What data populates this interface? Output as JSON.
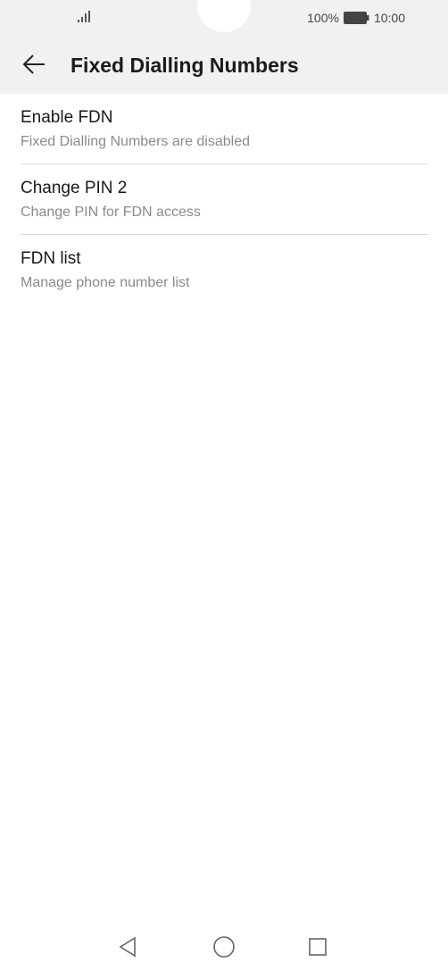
{
  "status_bar": {
    "battery_percent": "100%",
    "time": "10:00"
  },
  "header": {
    "title": "Fixed Dialling Numbers"
  },
  "items": [
    {
      "title": "Enable FDN",
      "subtitle": "Fixed Dialling Numbers are disabled"
    },
    {
      "title": "Change PIN 2",
      "subtitle": "Change PIN for FDN access"
    },
    {
      "title": "FDN list",
      "subtitle": "Manage phone number list"
    }
  ],
  "icons": {
    "back": "arrow-back-icon",
    "signal": "signal-icon",
    "battery": "battery-icon",
    "nav_back": "triangle-back-icon",
    "nav_home": "circle-home-icon",
    "nav_recents": "square-recents-icon"
  },
  "colors": {
    "header_bg": "#f1f1f1",
    "title_text": "#1b1b1b",
    "subtitle_text": "#8a8a8a"
  }
}
